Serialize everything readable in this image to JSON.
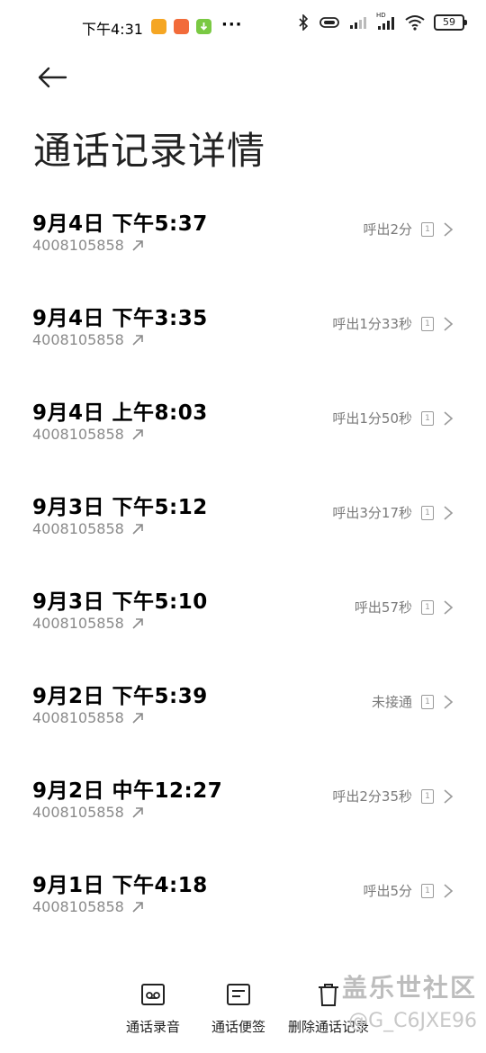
{
  "status_bar": {
    "time": "下午4:31",
    "battery": "59",
    "hd_label": "HD",
    "app_icons": [
      "orange-app-icon",
      "red-app-icon",
      "green-download-icon"
    ],
    "colors": {
      "app1": "#f5a623",
      "app2": "#f26b3a",
      "app3": "#7ac943"
    }
  },
  "header": {
    "title": "通话记录详情"
  },
  "calls": [
    {
      "datetime": "9月4日 下午5:37",
      "number": "4008105858",
      "duration": "呼出2分",
      "sim": "1"
    },
    {
      "datetime": "9月4日 下午3:35",
      "number": "4008105858",
      "duration": "呼出1分33秒",
      "sim": "1"
    },
    {
      "datetime": "9月4日 上午8:03",
      "number": "4008105858",
      "duration": "呼出1分50秒",
      "sim": "1"
    },
    {
      "datetime": "9月3日 下午5:12",
      "number": "4008105858",
      "duration": "呼出3分17秒",
      "sim": "1"
    },
    {
      "datetime": "9月3日 下午5:10",
      "number": "4008105858",
      "duration": "呼出57秒",
      "sim": "1"
    },
    {
      "datetime": "9月2日 下午5:39",
      "number": "4008105858",
      "duration": "未接通",
      "sim": "1"
    },
    {
      "datetime": "9月2日 中午12:27",
      "number": "4008105858",
      "duration": "呼出2分35秒",
      "sim": "1"
    },
    {
      "datetime": "9月1日 下午4:18",
      "number": "4008105858",
      "duration": "呼出5分",
      "sim": "1"
    }
  ],
  "bottom_actions": {
    "recording": "通话录音",
    "notes": "通话便签",
    "delete": "删除通话记录"
  },
  "watermark": {
    "brand": "盖乐世社区",
    "user": "@G_C6JXE96"
  }
}
